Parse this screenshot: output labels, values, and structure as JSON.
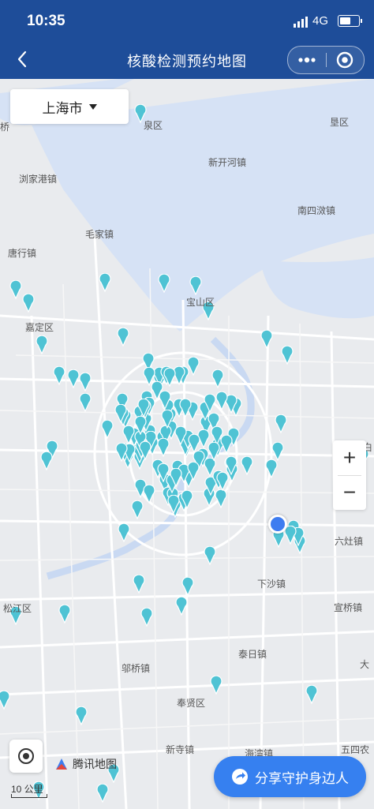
{
  "status": {
    "time": "10:35",
    "network": "4G",
    "battery_level": 0.6
  },
  "nav": {
    "title": "核酸检测预约地图"
  },
  "map": {
    "city": "上海市",
    "place_labels": [
      "泉区",
      "新开河镇",
      "浏家港镇",
      "南四滧镇",
      "毛家镇",
      "唐行镇",
      "嘉定区",
      "宝山区",
      "白",
      "六灶镇",
      "下沙镇",
      "宣桥镇",
      "松江区",
      "泰日镇",
      "邬桥镇",
      "奉贤区",
      "新寺镇",
      "海湾镇",
      "五四农",
      "大",
      "桥",
      "垦区"
    ],
    "brand": "腾讯地图",
    "scale": "10 公里",
    "zoom_in": "+",
    "zoom_out": "−"
  },
  "share": {
    "label": "分享守护身边人"
  },
  "colors": {
    "nav_bg": "#1e4d99",
    "pin": "#4fc3d4",
    "share_bg": "#3680f0",
    "water": "#d6e2f5",
    "land": "#e9ebee"
  },
  "icons": {
    "back": "back-arrow-icon",
    "more": "more-dots-icon",
    "target": "target-icon",
    "locate": "locate-icon",
    "share": "share-arrow-icon",
    "brand": "tencent-map-logo"
  },
  "site_count": 140
}
